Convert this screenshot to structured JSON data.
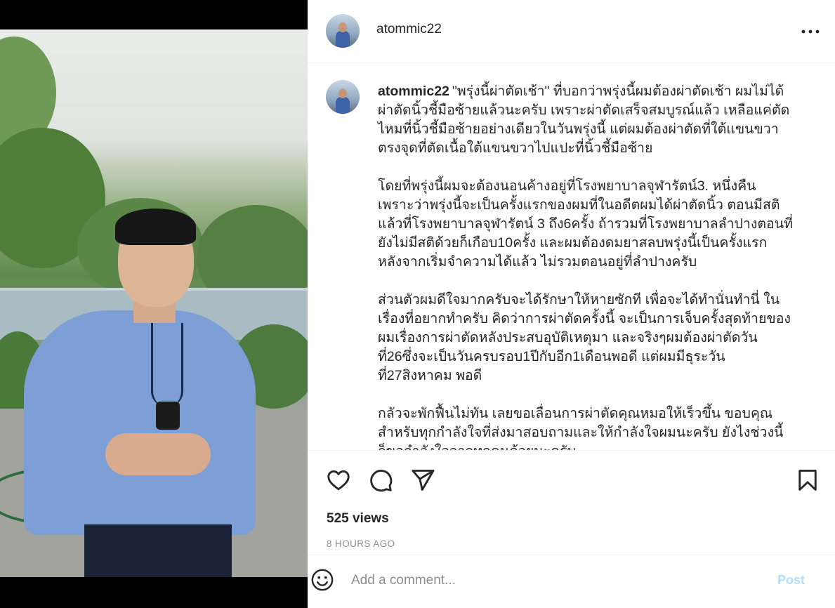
{
  "post": {
    "username": "atommic22",
    "more_icon": "more-horizontal-icon"
  },
  "caption": {
    "username": "atommic22",
    "paragraphs": [
      [
        "\"พรุ่งนี้ผ่าตัดเช้า\" ที่บอกว่าพรุ่งนี้ผมต้องผ่าตัดเช้า ผมไม่ได้",
        "ผ่าตัดนิ้วชี้มือซ้ายแล้วนะครับ เพราะผ่าตัดเสร็จสมบูรณ์แล้ว เหลือแค่ตัด",
        "ไหมที่นิ้วชี้มือซ้ายอย่างเดียวในวันพรุ่งนี้ แต่ผมต้องผ่าตัดที่ใต้แขนขวา",
        "ตรงจุดที่ตัดเนื้อใต้แขนขวาไปแปะที่นิ้วชี้มือซ้าย"
      ],
      [
        "โดยที่พรุ่งนี้ผมจะต้องนอนค้างอยู่ที่โรงพยาบาลจุฬารัตน์3. หนึ่งคืน",
        "เพราะว่าพรุ่งนี้จะเป็นครั้งแรกของผมที่ในอดีตผมได้ผ่าตัดนิ้ว ตอนมีสติ",
        "แล้วที่โรงพยาบาลจุฬารัตน์ 3 ถึง6ครั้ง ถ้ารวมที่โรงพยาบาลลำปางตอนที่",
        "ยังไม่มีสติด้วยก็เกือบ10ครั้ง และผมต้องดมยาสลบพรุ่งนี้เป็นครั้งแรก",
        "หลังจากเริ่มจำความได้แล้ว ไม่รวมตอนอยู่ที่ลำปางครับ"
      ],
      [
        "ส่วนตัวผมดีใจมากครับจะได้รักษาให้หายซักที เพื่อจะได้ทำนั่นทำนี่ ใน",
        "เรื่องที่อยากทำครับ คิดว่าการผ่าตัดครั้งนี้ จะเป็นการเจ็บครั้งสุดท้ายของ",
        "ผมเรื่องการผ่าตัดหลังประสบอุบัติเหตุมา และจริงๆผมต้องผ่าตัดวัน",
        "ที่26ซึ่งจะเป็นวันครบรอบ1ปีกับอีก1เดือนพอดี แต่ผมมีธุระวัน",
        "ที่27สิงหาคม พอดี"
      ],
      [
        "กลัวจะพักฟื้นไม่ทัน เลยขอเลื่อนการผ่าตัดคุณหมอให้เร็วขึ้น ขอบคุณ",
        "สำหรับทุกกำลังใจที่ส่งมาสอบถามและให้กำลังใจผมนะครับ ยังไงช่วงนี้",
        "ก็ขอกำลังใจจากทุกคนด้วยนะครับ"
      ]
    ]
  },
  "actions": {
    "like_icon": "heart-icon",
    "comment_icon": "comment-bubble-icon",
    "share_icon": "paper-plane-icon",
    "save_icon": "bookmark-icon"
  },
  "stats": {
    "views": "525 views",
    "timestamp": "8 HOURS AGO"
  },
  "comment_box": {
    "emoji_icon": "smiley-icon",
    "placeholder": "Add a comment...",
    "post_label": "Post"
  }
}
